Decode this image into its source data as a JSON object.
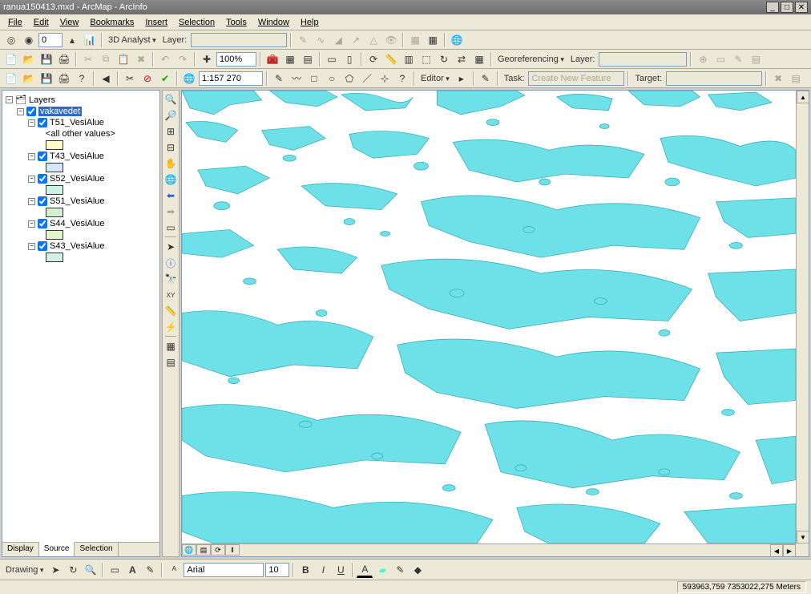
{
  "title": "ranua150413.mxd - ArcMap - ArcInfo",
  "menu": [
    "File",
    "Edit",
    "View",
    "Bookmarks",
    "Insert",
    "Selection",
    "Tools",
    "Window",
    "Help"
  ],
  "toolbar1": {
    "analyst": "3D Analyst",
    "layer_label": "Layer:",
    "spin_value": "0"
  },
  "toolbar2": {
    "zoom": "100%",
    "georef": "Georeferencing",
    "layer_label": "Layer:"
  },
  "toolbar3": {
    "scale": "1:157 270",
    "editor": "Editor",
    "task_label": "Task:",
    "task_value": "Create New Feature",
    "target_label": "Target:"
  },
  "toc": {
    "root": "Layers",
    "selected": "vakavedet",
    "items": [
      {
        "name": "T51_VesiAlue",
        "sublabel": "<all other values>",
        "swatch": "#ffffcc"
      },
      {
        "name": "T43_VesiAlue",
        "swatch": "#d4e8ff"
      },
      {
        "name": "S52_VesiAlue",
        "swatch": "#ccf2e8"
      },
      {
        "name": "S51_VesiAlue",
        "swatch": "#d4f0d4"
      },
      {
        "name": "S44_VesiAlue",
        "swatch": "#e0f5cc"
      },
      {
        "name": "S43_VesiAlue",
        "swatch": "#d4f0e8"
      }
    ],
    "tabs": [
      "Display",
      "Source",
      "Selection"
    ],
    "active_tab": "Source"
  },
  "drawing": {
    "label": "Drawing",
    "font": "Arial",
    "size": "10"
  },
  "status": {
    "coords": "593963,759 7353022,275 Meters"
  },
  "colors": {
    "water": "#6ee0e8",
    "water_stroke": "#2fa8b0"
  }
}
